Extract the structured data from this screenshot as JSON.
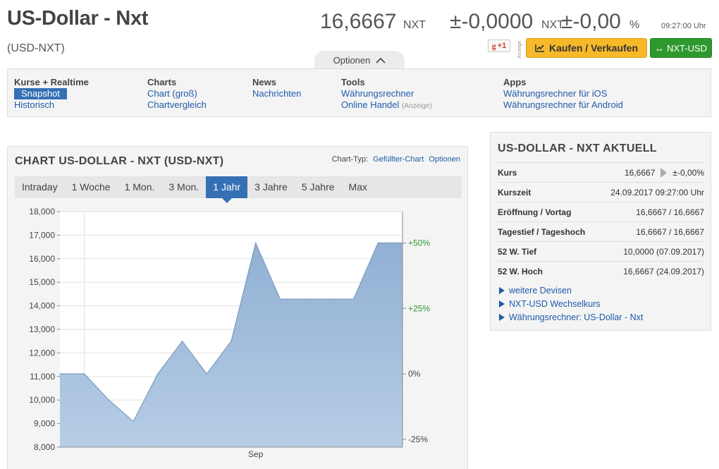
{
  "header": {
    "title": "US-Dollar - Nxt",
    "symbol": "(USD-NXT)",
    "price": "16,6667",
    "price_unit": "NXT",
    "change": "±-0,0000",
    "change_unit": "NXT",
    "change_pct": "±-0,00",
    "change_pct_unit": "%",
    "time": "09:27:00 Uhr",
    "gplus_label": "+1",
    "gplus_letter": "g",
    "anzeige": "Anzeige",
    "buy_label": "Kaufen / Verkaufen",
    "invert_label": "NXT-USD",
    "invert_arrow": "↔",
    "options_label": "Optionen"
  },
  "nav": {
    "kurse": {
      "heading": "Kurse + Realtime",
      "items": [
        "Snapshot",
        "Historisch"
      ]
    },
    "charts": {
      "heading": "Charts",
      "items": [
        "Chart (groß)",
        "Chartvergleich"
      ]
    },
    "news": {
      "heading": "News",
      "items": [
        "Nachrichten"
      ]
    },
    "tools": {
      "heading": "Tools",
      "items": [
        "Währungsrechner",
        "Online Handel"
      ],
      "anzeige": "(Anzeige)"
    },
    "apps": {
      "heading": "Apps",
      "items": [
        "Währungsrechner für iOS",
        "Währungsrechner für Android"
      ]
    }
  },
  "chart_panel": {
    "title": "CHART US-DOLLAR - NXT (USD-NXT)",
    "type_label": "Chart-Typ:",
    "type_value": "Gefüllter-Chart",
    "options": "Optionen",
    "ranges": [
      "Intraday",
      "1 Woche",
      "1 Mon.",
      "3 Mon.",
      "1 Jahr",
      "3 Jahre",
      "5 Jahre",
      "Max"
    ],
    "active_range": 4
  },
  "chart_data": {
    "type": "area",
    "x": [
      0,
      1,
      2,
      3,
      4,
      5,
      6,
      7,
      8,
      9,
      10,
      11,
      12,
      13,
      14
    ],
    "values": [
      11111,
      11111,
      10000,
      9091,
      11111,
      12500,
      11111,
      12500,
      16667,
      14286,
      14286,
      14286,
      14286,
      16667,
      16667
    ],
    "ylim": [
      8000,
      18000
    ],
    "y_ticks": [
      "8,000",
      "9,000",
      "10,000",
      "11,000",
      "12,000",
      "13,000",
      "14,000",
      "15,000",
      "16,000",
      "17,000",
      "18,000"
    ],
    "y_tick_values": [
      8000,
      9000,
      10000,
      11000,
      12000,
      13000,
      14000,
      15000,
      16000,
      17000,
      18000
    ],
    "right_ticks": [
      "-25%",
      "0%",
      "+25%",
      "+50%"
    ],
    "right_tick_values": [
      8333.25,
      11111,
      13888.75,
      16666.5
    ],
    "x_tick_labels": [
      "Sep"
    ],
    "x_tick_positions": [
      8
    ],
    "grid": true,
    "colors": {
      "fill": "#a8c2de",
      "line": "#7d9cbe",
      "positive": "#2e9a2e"
    }
  },
  "quote_panel": {
    "title": "US-DOLLAR - NXT AKTUELL",
    "rows": [
      {
        "label": "Kurs",
        "value": "16,6667",
        "extra": "±-0,00%"
      },
      {
        "label": "Kurszeit",
        "value": "24.09.2017 09:27:00 Uhr"
      },
      {
        "label": "Eröffnung / Vortag",
        "value": "16,6667 / 16,6667"
      },
      {
        "label": "Tagestief / Tageshoch",
        "value": "16,6667 / 16,6667"
      },
      {
        "label": "52 W. Tief",
        "value": "10,0000 (07.09.2017)"
      },
      {
        "label": "52 W. Hoch",
        "value": "16,6667 (24.09.2017)"
      }
    ],
    "links": [
      "weitere Devisen",
      "NXT-USD Wechselkurs",
      "Währungsrechner: US-Dollar - Nxt"
    ]
  }
}
